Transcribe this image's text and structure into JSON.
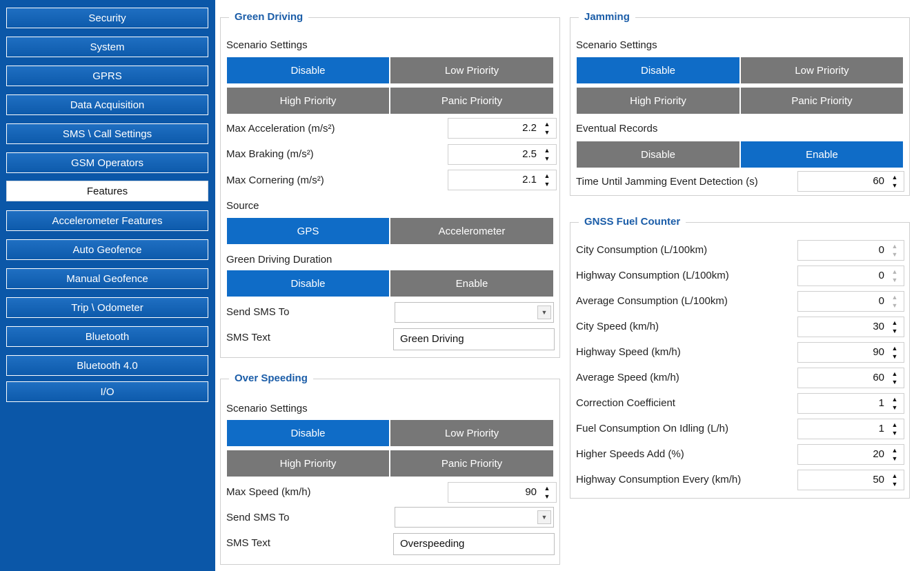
{
  "sidebar": {
    "items": [
      {
        "label": "Security"
      },
      {
        "label": "System"
      },
      {
        "label": "GPRS"
      },
      {
        "label": "Data Acquisition"
      },
      {
        "label": "SMS \\ Call Settings"
      },
      {
        "label": "GSM Operators"
      },
      {
        "label": "Features"
      },
      {
        "label": "Accelerometer Features"
      },
      {
        "label": "Auto Geofence"
      },
      {
        "label": "Manual Geofence"
      },
      {
        "label": "Trip \\ Odometer"
      },
      {
        "label": "Bluetooth"
      },
      {
        "label": "Bluetooth 4.0"
      },
      {
        "label": "I/O"
      }
    ],
    "active_item": "Features"
  },
  "green_driving": {
    "title": "Green Driving",
    "scenario_label": "Scenario Settings",
    "scenario_options": [
      "Disable",
      "Low Priority",
      "High Priority",
      "Panic Priority"
    ],
    "scenario_selected": "Disable",
    "max_acceleration": {
      "label": "Max Acceleration (m/s²)",
      "value": "2.2"
    },
    "max_braking": {
      "label": "Max Braking (m/s²)",
      "value": "2.5"
    },
    "max_cornering": {
      "label": "Max Cornering (m/s²)",
      "value": "2.1"
    },
    "source_label": "Source",
    "source_options": [
      "GPS",
      "Accelerometer"
    ],
    "source_selected": "GPS",
    "duration_label": "Green Driving Duration",
    "duration_options": [
      "Disable",
      "Enable"
    ],
    "duration_selected": "Disable",
    "send_sms_label": "Send SMS To",
    "send_sms_value": "",
    "sms_text_label": "SMS Text",
    "sms_text_value": "Green Driving"
  },
  "over_speeding": {
    "title": "Over Speeding",
    "scenario_label": "Scenario Settings",
    "scenario_options": [
      "Disable",
      "Low Priority",
      "High Priority",
      "Panic Priority"
    ],
    "scenario_selected": "Disable",
    "max_speed": {
      "label": "Max Speed (km/h)",
      "value": "90"
    },
    "send_sms_label": "Send SMS To",
    "send_sms_value": "",
    "sms_text_label": "SMS Text",
    "sms_text_value": "Overspeeding"
  },
  "jamming": {
    "title": "Jamming",
    "scenario_label": "Scenario Settings",
    "scenario_options": [
      "Disable",
      "Low Priority",
      "High Priority",
      "Panic Priority"
    ],
    "scenario_selected": "Disable",
    "eventual_label": "Eventual Records",
    "eventual_options": [
      "Disable",
      "Enable"
    ],
    "eventual_selected": "Enable",
    "detection_time": {
      "label": "Time Until Jamming Event Detection (s)",
      "value": "60"
    }
  },
  "gnss_fuel": {
    "title": "GNSS Fuel Counter",
    "fields": [
      {
        "label": "City Consumption (L/100km)",
        "value": "0"
      },
      {
        "label": "Highway Consumption (L/100km)",
        "value": "0"
      },
      {
        "label": "Average Consumption (L/100km)",
        "value": "0"
      },
      {
        "label": "City Speed (km/h)",
        "value": "30"
      },
      {
        "label": "Highway Speed (km/h)",
        "value": "90"
      },
      {
        "label": "Average Speed (km/h)",
        "value": "60"
      },
      {
        "label": "Correction Coefficient",
        "value": "1"
      },
      {
        "label": "Fuel Consumption On Idling (L/h)",
        "value": "1"
      },
      {
        "label": "Higher Speeds Add (%)",
        "value": "20"
      },
      {
        "label": "Highway Consumption Every (km/h)",
        "value": "50"
      }
    ]
  },
  "colors": {
    "sidebar_bg": "#0b57a8",
    "selected_option": "#0f6cc7",
    "unselected_option": "#777777",
    "group_title": "#1b5da8"
  }
}
